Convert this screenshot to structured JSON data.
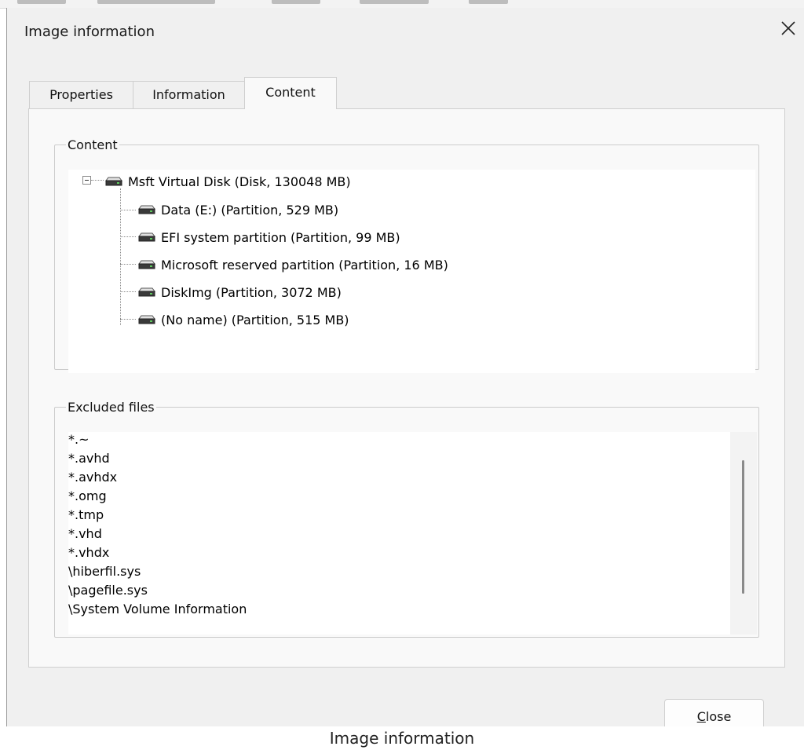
{
  "window": {
    "title": "Image information",
    "close_icon": "close-icon"
  },
  "tabs": [
    {
      "label": "Properties",
      "active": false
    },
    {
      "label": "Information",
      "active": false
    },
    {
      "label": "Content",
      "active": true
    }
  ],
  "content_group": {
    "legend": "Content",
    "tree": {
      "root": {
        "label": "Msft Virtual Disk (Disk, 130048 MB)",
        "icon": "disk-icon",
        "expanded": true
      },
      "children": [
        {
          "label": "Data (E:) (Partition, 529 MB)",
          "icon": "disk-icon"
        },
        {
          "label": "EFI system partition (Partition, 99 MB)",
          "icon": "disk-icon"
        },
        {
          "label": "Microsoft reserved partition (Partition, 16 MB)",
          "icon": "disk-icon"
        },
        {
          "label": "DiskImg (Partition, 3072 MB)",
          "icon": "disk-icon"
        },
        {
          "label": "(No name) (Partition, 515 MB)",
          "icon": "disk-icon"
        }
      ]
    }
  },
  "excluded_group": {
    "legend": "Excluded files",
    "items": [
      "*.~",
      "*.avhd",
      "*.avhdx",
      "*.omg",
      "*.tmp",
      "*.vhd",
      "*.vhdx",
      "\\hiberfil.sys",
      "\\pagefile.sys",
      "\\System Volume Information"
    ]
  },
  "buttons": {
    "close_mnemonic": "C",
    "close_rest": "lose"
  },
  "caption": "Image information",
  "colors": {
    "dialog_bg": "#f0f0f0",
    "panel_bg": "#f9f9f9",
    "border": "#cfcfcf"
  }
}
